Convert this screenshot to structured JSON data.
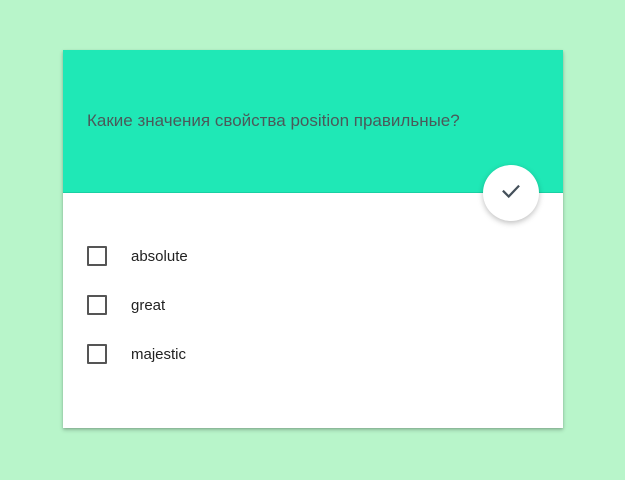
{
  "quiz": {
    "question": "Какие значения свойства position правильные?",
    "submit_icon": "check-icon",
    "options": [
      {
        "label": "absolute",
        "checked": false
      },
      {
        "label": "great",
        "checked": false
      },
      {
        "label": "majestic",
        "checked": false
      }
    ]
  },
  "colors": {
    "page_background": "#b8f5ca",
    "header_background": "#1fe8b6",
    "card_background": "#ffffff"
  }
}
